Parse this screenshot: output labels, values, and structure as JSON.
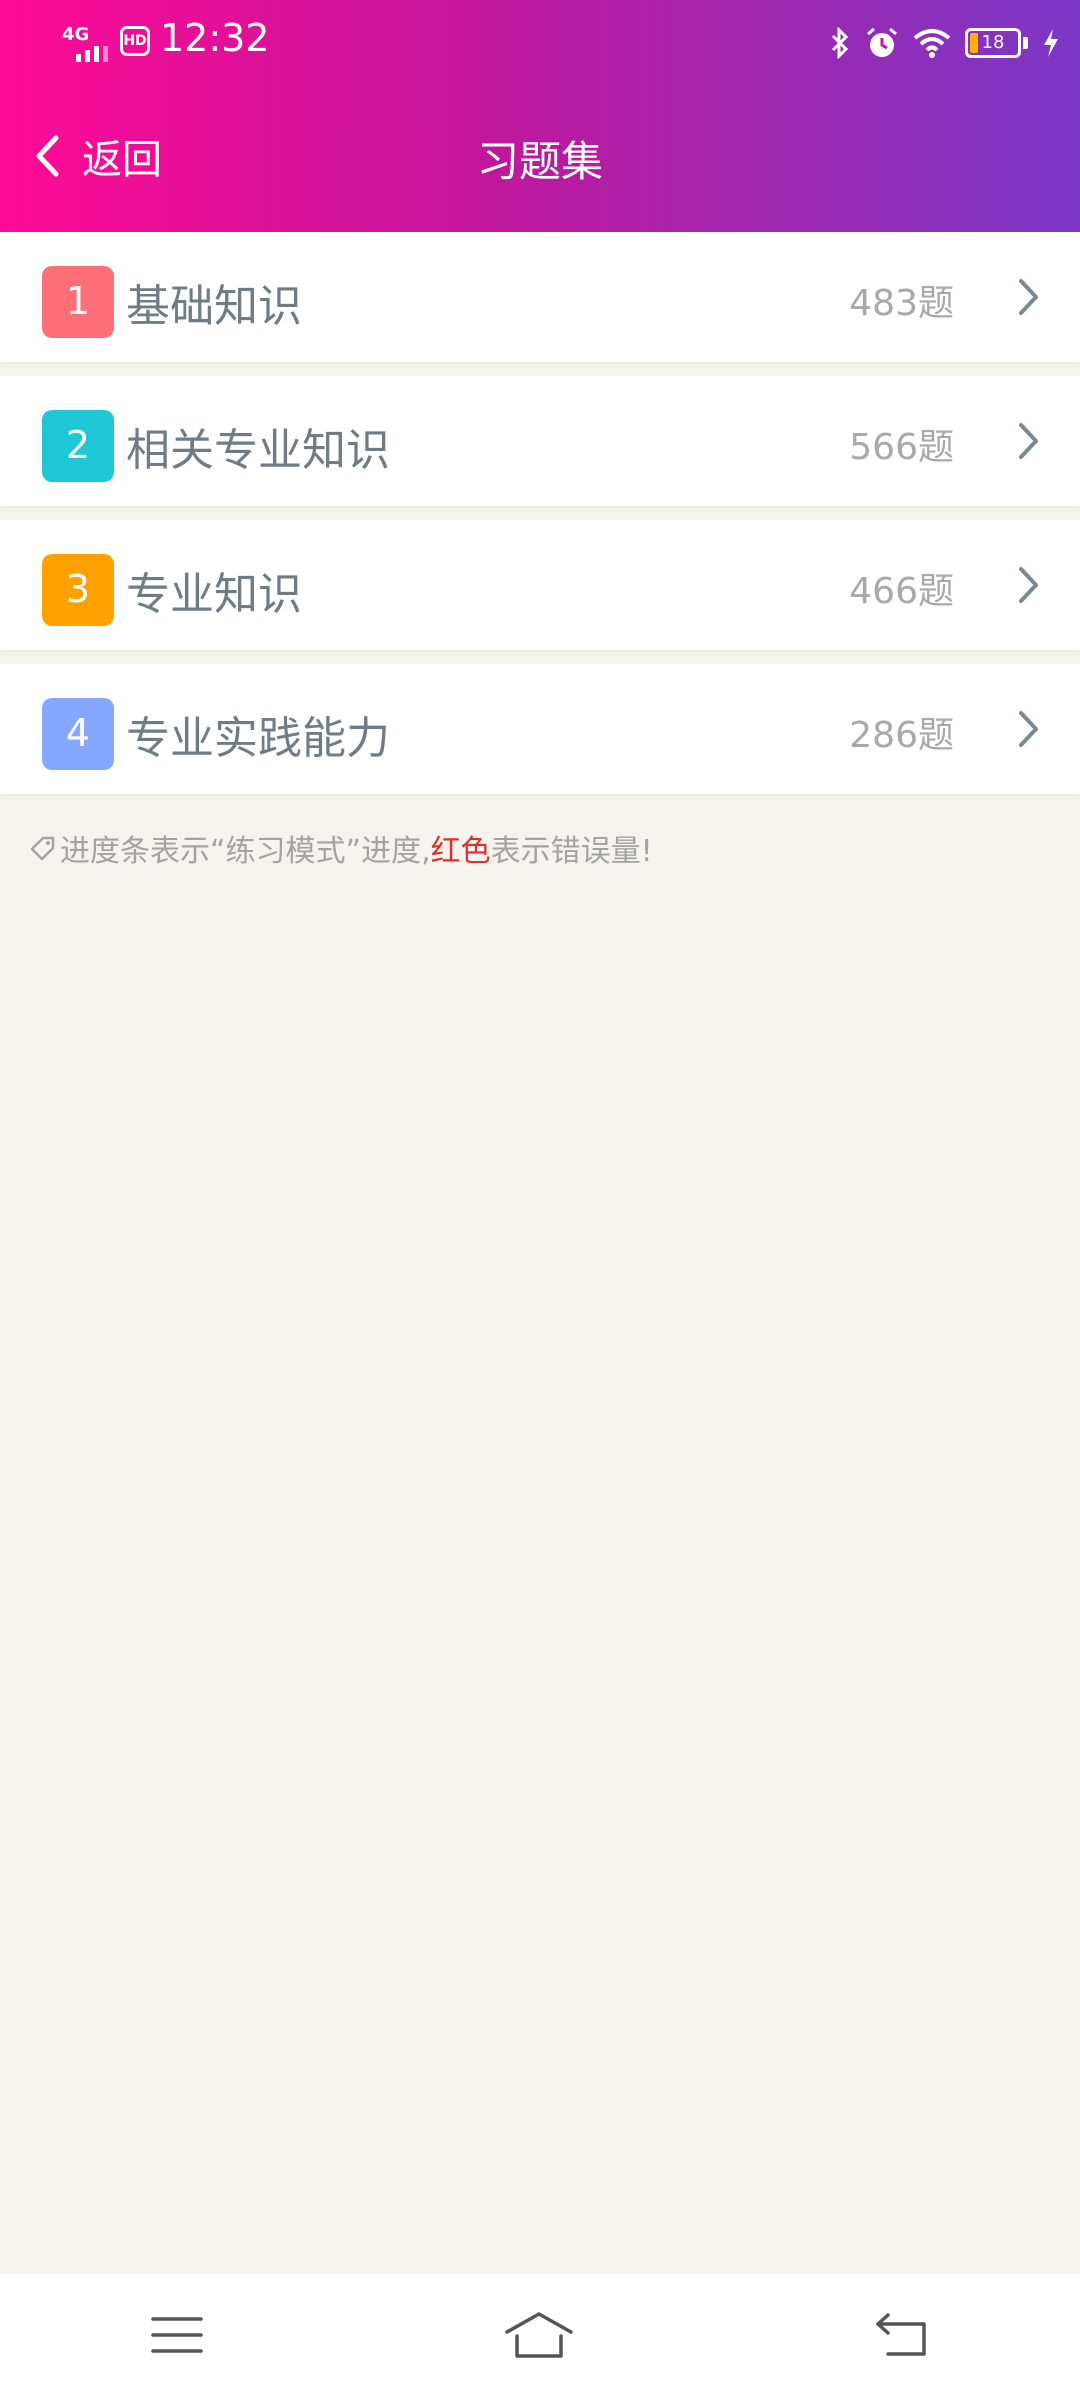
{
  "status_bar": {
    "network": "4G",
    "hd": "HD",
    "time": "12:32",
    "battery": "18",
    "icons": [
      "bluetooth-icon",
      "alarm-icon",
      "wifi-icon",
      "battery-icon",
      "charging-icon"
    ]
  },
  "nav": {
    "back_label": "返回",
    "title": "习题集"
  },
  "items": [
    {
      "index": "1",
      "title": "基础知识",
      "count": "483题",
      "color": "#ff6f77"
    },
    {
      "index": "2",
      "title": "相关专业知识",
      "count": "566题",
      "color": "#1ec8d6"
    },
    {
      "index": "3",
      "title": "专业知识",
      "count": "466题",
      "color": "#ffa200"
    },
    {
      "index": "4",
      "title": "专业实践能力",
      "count": "286题",
      "color": "#86a7ff"
    }
  ],
  "note": {
    "prefix": "进度条表示“练习模式”进度,",
    "red": "红色",
    "suffix": "表示错误量!"
  },
  "colors": {
    "header_gradient": [
      "#ff0a96",
      "#c0179c",
      "#7a38c6"
    ],
    "background": "#f7f3ee",
    "accent_red": "#e02e2e"
  }
}
